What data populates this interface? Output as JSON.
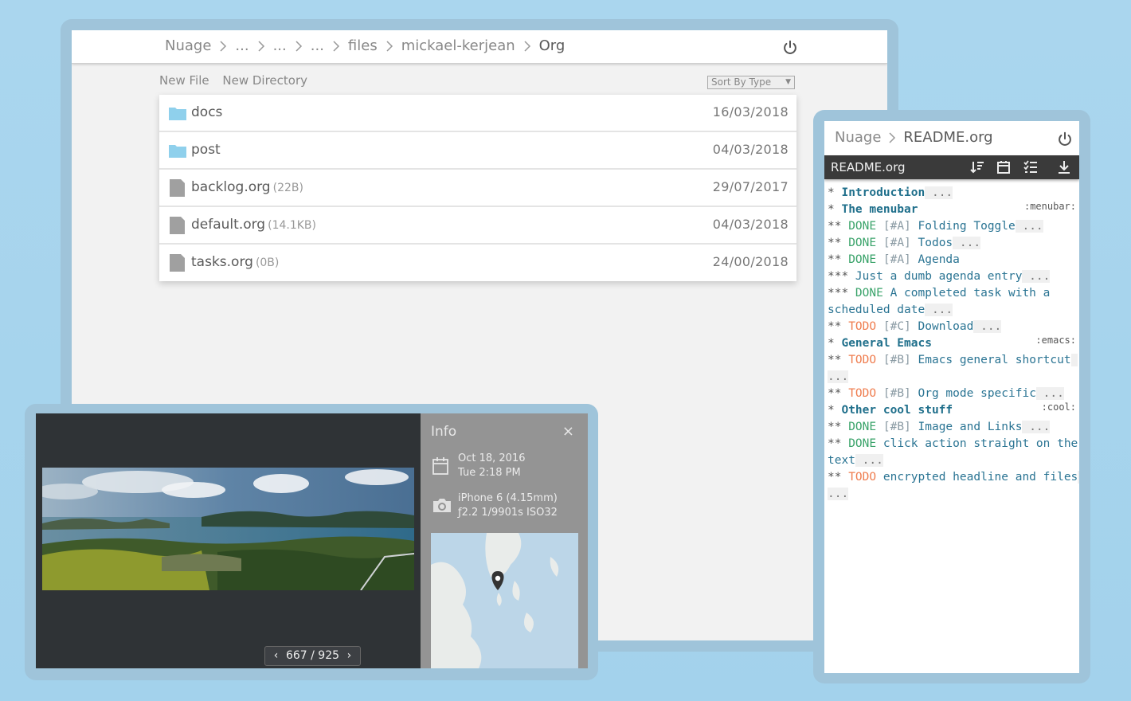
{
  "file_browser": {
    "breadcrumb": [
      "Nuage",
      "...",
      "...",
      "...",
      "files",
      "mickael-kerjean",
      "Org"
    ],
    "actions": {
      "new_file": "New File",
      "new_directory": "New Directory"
    },
    "sort": {
      "selected": "Sort By Type"
    },
    "files": [
      {
        "name": "docs",
        "type": "folder",
        "size": "",
        "date": "16/03/2018"
      },
      {
        "name": "post",
        "type": "folder",
        "size": "",
        "date": "04/03/2018"
      },
      {
        "name": "backlog.org",
        "type": "file",
        "size": "(22B)",
        "date": "29/07/2017"
      },
      {
        "name": "default.org",
        "type": "file",
        "size": "(14.1KB)",
        "date": "04/03/2018"
      },
      {
        "name": "tasks.org",
        "type": "file",
        "size": "(0B)",
        "date": "24/00/2018"
      }
    ],
    "colors": {
      "folder": "#8fd0ec",
      "file": "#a0a0a0"
    }
  },
  "org_viewer": {
    "breadcrumb": [
      "Nuage",
      "README.org"
    ],
    "toolbar_title": "README.org",
    "toolbar_icons": [
      "sort-icon",
      "calendar-icon",
      "checklist-icon",
      "download-icon"
    ],
    "lines": [
      {
        "stars": "* ",
        "kw": "",
        "pri": "",
        "text": "Introduction",
        "ell": " ...",
        "tag": "",
        "level": 1
      },
      {
        "stars": "* ",
        "kw": "",
        "pri": "",
        "text": "The menubar",
        "ell": "",
        "tag": ":menubar:",
        "level": 1
      },
      {
        "stars": "** ",
        "kw": "DONE",
        "pri": "[#A]",
        "text": "Folding Toggle",
        "ell": " ...",
        "tag": "",
        "level": 2
      },
      {
        "stars": "** ",
        "kw": "DONE",
        "pri": "[#A]",
        "text": "Todos",
        "ell": " ...",
        "tag": "",
        "level": 2
      },
      {
        "stars": "** ",
        "kw": "DONE",
        "pri": "[#A]",
        "text": "Agenda",
        "ell": "",
        "tag": "",
        "level": 2
      },
      {
        "stars": "*** ",
        "kw": "",
        "pri": "",
        "text": "Just a dumb agenda entry",
        "ell": " ...",
        "tag": "",
        "level": 3
      },
      {
        "stars": "*** ",
        "kw": "DONE",
        "pri": "",
        "text": "A completed task with a scheduled date",
        "ell": " ...",
        "tag": "",
        "level": 3
      },
      {
        "stars": "** ",
        "kw": "TODO",
        "pri": "[#C]",
        "text": "Download",
        "ell": " ...",
        "tag": "",
        "level": 2
      },
      {
        "stars": "* ",
        "kw": "",
        "pri": "",
        "text": "General Emacs",
        "ell": "",
        "tag": ":emacs:",
        "level": 1
      },
      {
        "stars": "** ",
        "kw": "TODO",
        "pri": "[#B]",
        "text": "Emacs general shortcut",
        "ell": " ...",
        "tag": "",
        "level": 2
      },
      {
        "stars": "** ",
        "kw": "TODO",
        "pri": "[#B]",
        "text": "Org mode specific",
        "ell": " ...",
        "tag": "",
        "level": 2
      },
      {
        "stars": "* ",
        "kw": "",
        "pri": "",
        "text": "Other cool stuff",
        "ell": "",
        "tag": ":cool:",
        "level": 1
      },
      {
        "stars": "** ",
        "kw": "DONE",
        "pri": "[#B]",
        "text": "Image and Links",
        "ell": " ...",
        "tag": "",
        "level": 2
      },
      {
        "stars": "** ",
        "kw": "DONE",
        "pri": "",
        "text": "click action straight on the text",
        "ell": " ...",
        "tag": "",
        "level": 2
      },
      {
        "stars": "** ",
        "kw": "TODO",
        "pri": "",
        "text": "encrypted headline and files",
        "ell": " ...",
        "tag": "",
        "level": 2
      }
    ]
  },
  "image_viewer": {
    "pager": "667 / 925",
    "info": {
      "title": "Info",
      "close": "×",
      "date_line1": "Oct 18, 2016",
      "date_line2": "Tue 2:18 PM",
      "camera_line1": "iPhone 6 (4.15mm)",
      "camera_line2": "ƒ2.2 1/9901s ISO32"
    }
  }
}
